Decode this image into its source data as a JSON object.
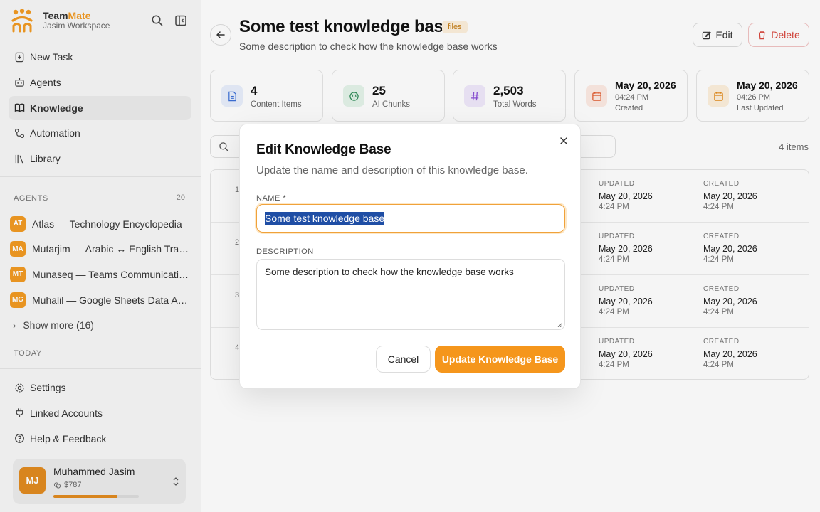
{
  "brand": {
    "name_prefix": "Team",
    "name_suffix": "Mate",
    "workspace": "Jasim Workspace"
  },
  "sidebar": {
    "nav": [
      {
        "label": "New Task",
        "icon": "new-task-icon"
      },
      {
        "label": "Agents",
        "icon": "robot-icon"
      },
      {
        "label": "Knowledge",
        "icon": "book-icon",
        "active": true
      },
      {
        "label": "Automation",
        "icon": "workflow-icon"
      },
      {
        "label": "Library",
        "icon": "library-icon"
      }
    ],
    "agents_label": "AGENTS",
    "agents_count": "20",
    "agents": [
      {
        "initials": "AT",
        "label": "Atlas — Technology Encyclopedia"
      },
      {
        "initials": "MA",
        "label": "Mutarjim — Arabic ↔ English Translator"
      },
      {
        "initials": "MT",
        "label": "Munaseq — Teams Communication Assistant"
      },
      {
        "initials": "MG",
        "label": "Muhalil — Google Sheets Data Analyst"
      }
    ],
    "show_more": "Show more (16)",
    "today_label": "TODAY",
    "bottom": [
      {
        "label": "Settings",
        "icon": "gear-icon"
      },
      {
        "label": "Linked Accounts",
        "icon": "plug-icon"
      },
      {
        "label": "Help & Feedback",
        "icon": "help-icon"
      }
    ],
    "user": {
      "initials": "MJ",
      "name": "Muhammed Jasim",
      "credits": "$787",
      "credit_fraction": 0.75
    }
  },
  "header": {
    "title": "Some test knowledge base",
    "badge": "files",
    "description": "Some description to check how the knowledge base works",
    "edit_label": "Edit",
    "delete_label": "Delete"
  },
  "stats": [
    {
      "value": "4",
      "label": "Content Items",
      "icon": "document-icon",
      "color": "#3b6fd8",
      "bg": "#e8effc"
    },
    {
      "value": "25",
      "label": "AI Chunks",
      "icon": "brain-icon",
      "color": "#2e8b57",
      "bg": "#e4f4ea"
    },
    {
      "value": "2,503",
      "label": "Total Words",
      "icon": "hash-icon",
      "color": "#8a4fd8",
      "bg": "#f0e8fb"
    }
  ],
  "date_stats": [
    {
      "date": "May 20, 2026",
      "time": "04:24 PM",
      "label": "Created",
      "icon": "calendar-icon",
      "color": "#e2582b",
      "bg": "#fdebe3"
    },
    {
      "date": "May 20, 2026",
      "time": "04:26 PM",
      "label": "Last Updated",
      "icon": "calendar-icon",
      "color": "#e38a1b",
      "bg": "#fdf0dc"
    }
  ],
  "items_count": "4 items",
  "table": {
    "updated_header": "UPDATED",
    "created_header": "CREATED",
    "rows": [
      {
        "num": "1",
        "updated_date": "May 20, 2026",
        "updated_time": "4:24 PM",
        "created_date": "May 20, 2026",
        "created_time": "4:24 PM"
      },
      {
        "num": "2",
        "updated_date": "May 20, 2026",
        "updated_time": "4:24 PM",
        "created_date": "May 20, 2026",
        "created_time": "4:24 PM"
      },
      {
        "num": "3",
        "updated_date": "May 20, 2026",
        "updated_time": "4:24 PM",
        "created_date": "May 20, 2026",
        "created_time": "4:24 PM"
      },
      {
        "num": "4",
        "updated_date": "May 20, 2026",
        "updated_time": "4:24 PM",
        "created_date": "May 20, 2026",
        "created_time": "4:24 PM"
      }
    ]
  },
  "modal": {
    "title": "Edit Knowledge Base",
    "subtitle": "Update the name and description of this knowledge base.",
    "name_label": "NAME *",
    "name_value": "Some test knowledge base",
    "description_label": "DESCRIPTION",
    "description_value": "Some description to check how the knowledge base works",
    "cancel_label": "Cancel",
    "submit_label": "Update Knowledge Base"
  },
  "colors": {
    "accent": "#f5961c",
    "danger": "#d9453b",
    "selection": "#1f4ea5"
  }
}
